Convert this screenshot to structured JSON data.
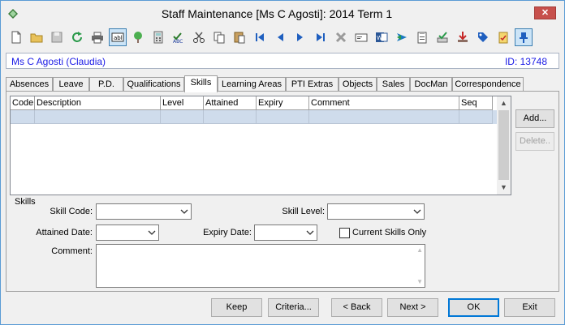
{
  "window": {
    "title": "Staff Maintenance  [Ms C Agosti]:  2014 Term 1",
    "close_label": "✕"
  },
  "toolbar": {
    "buttons": [
      {
        "name": "new-icon",
        "pressed": false
      },
      {
        "name": "open-folder-icon",
        "pressed": false
      },
      {
        "name": "save-icon",
        "pressed": false
      },
      {
        "name": "refresh-icon",
        "pressed": false
      },
      {
        "name": "print-icon",
        "pressed": false
      },
      {
        "name": "text-field-icon",
        "pressed": true
      },
      {
        "name": "tree-icon",
        "pressed": false
      },
      {
        "name": "calculator-icon",
        "pressed": false
      },
      {
        "name": "spell-check-icon",
        "pressed": false
      },
      {
        "name": "cut-icon",
        "pressed": false
      },
      {
        "name": "copy-icon",
        "pressed": false
      },
      {
        "name": "paste-icon",
        "pressed": false
      },
      {
        "name": "first-record-icon",
        "pressed": false
      },
      {
        "name": "previous-record-icon",
        "pressed": false
      },
      {
        "name": "next-record-icon",
        "pressed": false
      },
      {
        "name": "last-record-icon",
        "pressed": false
      },
      {
        "name": "delete-icon",
        "pressed": false
      },
      {
        "name": "card-icon",
        "pressed": false
      },
      {
        "name": "word-document-icon",
        "pressed": false
      },
      {
        "name": "send-icon",
        "pressed": false
      },
      {
        "name": "clipboard-list-icon",
        "pressed": false
      },
      {
        "name": "approve-icon",
        "pressed": false
      },
      {
        "name": "download-icon",
        "pressed": false
      },
      {
        "name": "tag-icon",
        "pressed": false
      },
      {
        "name": "checklist-icon",
        "pressed": false
      },
      {
        "name": "pin-icon",
        "pressed": true
      }
    ]
  },
  "staff": {
    "name": "Ms C Agosti (Claudia)",
    "id_label": "ID: 13748"
  },
  "tabs": [
    {
      "label": "Absences",
      "active": false
    },
    {
      "label": "Leave",
      "active": false
    },
    {
      "label": "P.D.",
      "active": false
    },
    {
      "label": "Qualifications",
      "active": false
    },
    {
      "label": "Skills",
      "active": true
    },
    {
      "label": "Learning Areas",
      "active": false
    },
    {
      "label": "PTI Extras",
      "active": false
    },
    {
      "label": "Objects",
      "active": false
    },
    {
      "label": "Sales",
      "active": false
    },
    {
      "label": "DocMan",
      "active": false
    },
    {
      "label": "Correspondence",
      "active": false
    }
  ],
  "grid": {
    "columns": [
      "Code",
      "Description",
      "Level",
      "Attained",
      "Expiry",
      "Comment",
      "Seq"
    ],
    "rows": [
      [
        "",
        "",
        "",
        "",
        "",
        "",
        ""
      ]
    ]
  },
  "side_buttons": {
    "add": "Add...",
    "delete": "Delete.."
  },
  "skills_form": {
    "group_label": "Skills",
    "skill_code_label": "Skill Code:",
    "skill_code_value": "",
    "skill_level_label": "Skill Level:",
    "skill_level_value": "",
    "attained_date_label": "Attained Date:",
    "attained_date_value": "",
    "expiry_date_label": "Expiry Date:",
    "expiry_date_value": "",
    "current_only_label": "Current Skills Only",
    "current_only_checked": false,
    "comment_label": "Comment:",
    "comment_value": ""
  },
  "bottom_buttons": {
    "keep": "Keep",
    "criteria": "Criteria...",
    "back": "< Back",
    "next": "Next >",
    "ok": "OK",
    "exit": "Exit"
  },
  "colors": {
    "accent": "#1a1ae6",
    "selected_row": "#cfdcec",
    "close": "#c7504c"
  }
}
